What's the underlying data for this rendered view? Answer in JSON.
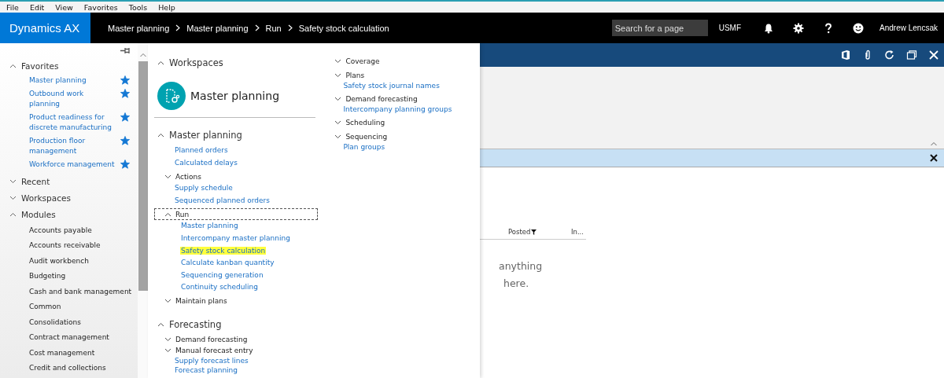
{
  "menu_bar": {
    "items": [
      "File",
      "Edit",
      "View",
      "Favorites",
      "Tools",
      "Help"
    ]
  },
  "header": {
    "app_name": "Dynamics AX",
    "breadcrumb": [
      "Master planning",
      "Master planning",
      "Run",
      "Safety stock calculation"
    ],
    "search": {
      "placeholder": "Search for a page"
    },
    "company": "USMF",
    "user_name": "Andrew Lencsak"
  },
  "nav_pane": {
    "sections": [
      {
        "label": "Favorites",
        "expanded": true,
        "items": [
          {
            "label": "Master planning",
            "starred": true
          },
          {
            "label": "Outbound work planning",
            "starred": true
          },
          {
            "label": "Product readiness for discrete manufacturing",
            "starred": true
          },
          {
            "label": "Production floor management",
            "starred": true
          },
          {
            "label": "Workforce management",
            "starred": true
          }
        ]
      },
      {
        "label": "Recent",
        "expanded": false
      },
      {
        "label": "Workspaces",
        "expanded": false
      },
      {
        "label": "Modules",
        "expanded": true,
        "items": [
          "Accounts payable",
          "Accounts receivable",
          "Audit workbench",
          "Budgeting",
          "Cash and bank management",
          "Common",
          "Consolidations",
          "Contract management",
          "Cost management",
          "Credit and collections"
        ]
      }
    ]
  },
  "flyout": {
    "columns": [
      [
        {
          "kind": "section",
          "label": "Workspaces",
          "expanded": true,
          "children": [
            {
              "kind": "tile",
              "label": "Master planning"
            }
          ]
        },
        {
          "kind": "section",
          "label": "Master planning",
          "expanded": true,
          "children": [
            {
              "kind": "link",
              "label": "Planned orders",
              "highlighted": false
            },
            {
              "kind": "link",
              "label": "Calculated delays",
              "highlighted": false
            },
            {
              "kind": "group",
              "label": "Actions",
              "expanded": false,
              "focused": false,
              "children": [
                {
                  "kind": "link",
                  "label": "Supply schedule",
                  "highlighted": false
                },
                {
                  "kind": "link",
                  "label": "Sequenced planned orders",
                  "highlighted": false
                }
              ]
            },
            {
              "kind": "group",
              "label": "Run",
              "expanded": true,
              "focused": true,
              "children": [
                {
                  "kind": "link",
                  "label": "Master planning",
                  "highlighted": false
                },
                {
                  "kind": "link",
                  "label": "Intercompany master planning",
                  "highlighted": false
                },
                {
                  "kind": "link",
                  "label": "Safety stock calculation",
                  "highlighted": true
                },
                {
                  "kind": "link",
                  "label": "Calculate kanban quantity",
                  "highlighted": false
                },
                {
                  "kind": "link",
                  "label": "Sequencing generation",
                  "highlighted": false
                },
                {
                  "kind": "link",
                  "label": "Continuity scheduling",
                  "highlighted": false
                }
              ]
            },
            {
              "kind": "group",
              "label": "Maintain plans",
              "expanded": false,
              "focused": false
            }
          ]
        },
        {
          "kind": "section",
          "label": "Forecasting",
          "expanded": true,
          "children": [
            {
              "kind": "group",
              "label": "Demand forecasting",
              "expanded": false,
              "focused": false
            },
            {
              "kind": "group",
              "label": "Manual forecast entry",
              "expanded": false,
              "focused": false,
              "children": [
                {
                  "kind": "link",
                  "label": "Supply forecast lines",
                  "highlighted": false
                },
                {
                  "kind": "link",
                  "label": "Forecast planning",
                  "highlighted": false
                }
              ]
            }
          ]
        }
      ],
      [
        {
          "kind": "group",
          "label": "Coverage",
          "expanded": false,
          "focused": false
        },
        {
          "kind": "group",
          "label": "Plans",
          "expanded": false,
          "focused": false,
          "children": [
            {
              "kind": "link",
              "label": "Safety stock journal names",
              "highlighted": false
            }
          ]
        },
        {
          "kind": "group",
          "label": "Demand forecasting",
          "expanded": false,
          "focused": false,
          "children": [
            {
              "kind": "link",
              "label": "Intercompany planning groups",
              "highlighted": false
            }
          ]
        },
        {
          "kind": "group",
          "label": "Scheduling",
          "expanded": false,
          "focused": false
        },
        {
          "kind": "group",
          "label": "Sequencing",
          "expanded": false,
          "focused": false,
          "children": [
            {
              "kind": "link",
              "label": "Plan groups",
              "highlighted": false
            }
          ]
        }
      ]
    ]
  },
  "page": {
    "column_headers": [
      {
        "label": "Posted",
        "filtered": true
      },
      {
        "label": "In...",
        "filtered": false
      }
    ],
    "empty_message": [
      "anything",
      "here."
    ]
  }
}
